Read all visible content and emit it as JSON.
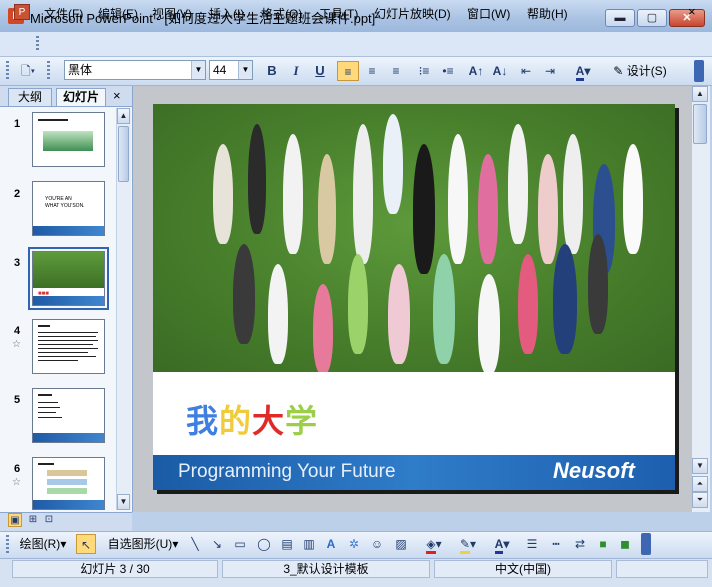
{
  "window": {
    "title": "Microsoft PowerPoint - [如何度过大学生活主题班会课件.ppt]",
    "minimize": "▬",
    "maximize": "▢",
    "close": "✕"
  },
  "menu": {
    "items": [
      "文件(F)",
      "编辑(E)",
      "视图(V)",
      "插入(I)",
      "格式(O)",
      "工具(T)",
      "幻灯片放映(D)",
      "窗口(W)",
      "帮助(H)"
    ],
    "close": "×"
  },
  "format_toolbar": {
    "font": "黑体",
    "size": "44",
    "bold": "B",
    "italic": "I",
    "underline": "U",
    "design": "设计(S)"
  },
  "left_pane": {
    "tabs": [
      "大纲",
      "幻灯片"
    ],
    "close": "×",
    "thumbnails": [
      {
        "num": "1",
        "lines": []
      },
      {
        "num": "2",
        "lines": [
          "YOU'RE AN",
          "WHAT YOU'SON."
        ]
      },
      {
        "num": "3",
        "lines": []
      },
      {
        "num": "4",
        "lines": []
      },
      {
        "num": "5",
        "lines": []
      },
      {
        "num": "6",
        "lines": []
      }
    ],
    "star": "☆"
  },
  "slide": {
    "title_chars": [
      "我",
      "的",
      "大",
      "学"
    ],
    "title_colors": [
      "#3f7fe0",
      "#f0cc3a",
      "#e02a2a",
      "#9bcf4a"
    ],
    "footer_text": "Programming Your Future",
    "brand": "Neusoft"
  },
  "draw_toolbar": {
    "draw": "绘图(R)",
    "autoshapes": "自选图形(U)"
  },
  "status": {
    "slide": "幻灯片 3 / 30",
    "template": "3_默认设计模板",
    "language": "中文(中国)"
  }
}
